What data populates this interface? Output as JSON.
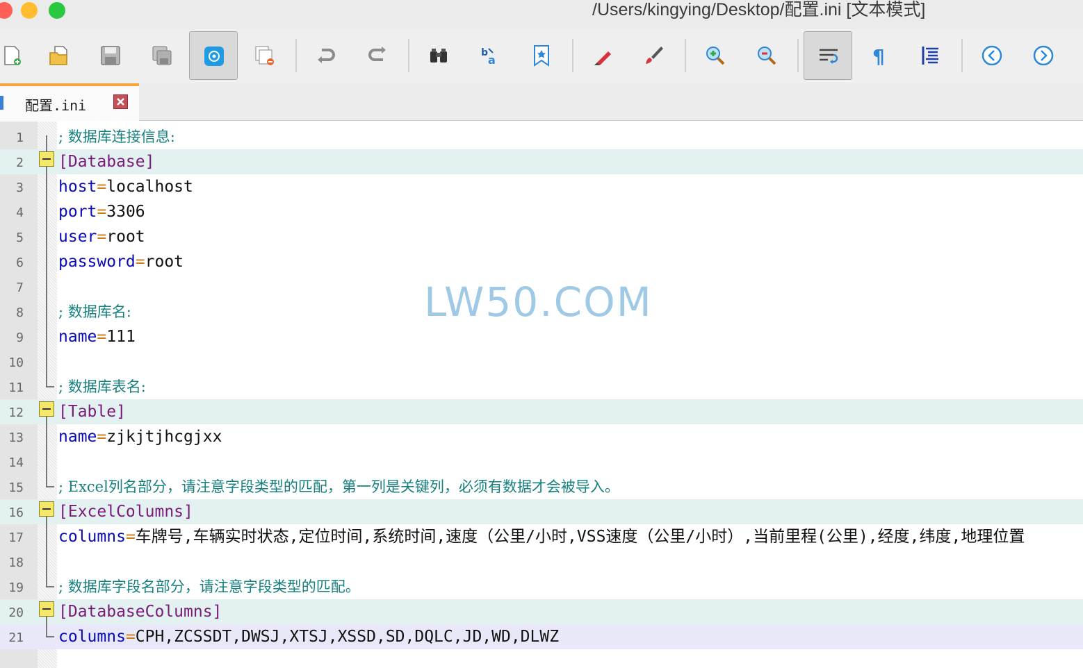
{
  "window": {
    "title": "/Users/kingying/Desktop/配置.ini [文本模式]"
  },
  "toolbar": {
    "buttons": [
      {
        "icon": "new-file-icon",
        "active": false
      },
      {
        "icon": "open-file-icon",
        "active": false
      },
      {
        "icon": "save-icon",
        "active": false
      },
      {
        "icon": "save-all-icon",
        "active": false
      },
      {
        "icon": "at-mode-icon",
        "active": true
      },
      {
        "icon": "close-file-icon",
        "active": false
      },
      {
        "icon": "undo-icon",
        "active": false
      },
      {
        "icon": "redo-icon",
        "active": false
      },
      {
        "icon": "find-icon",
        "active": false
      },
      {
        "icon": "replace-icon",
        "active": false
      },
      {
        "icon": "bookmark-icon",
        "active": false
      },
      {
        "icon": "marker-icon",
        "active": false
      },
      {
        "icon": "brush-icon",
        "active": false
      },
      {
        "icon": "zoom-in-icon",
        "active": false
      },
      {
        "icon": "zoom-out-icon",
        "active": false
      },
      {
        "icon": "word-wrap-icon",
        "active": true
      },
      {
        "icon": "show-symbols-icon",
        "active": false
      },
      {
        "icon": "indent-guide-icon",
        "active": false
      },
      {
        "icon": "previous-icon",
        "active": false
      },
      {
        "icon": "next-icon",
        "active": false
      }
    ]
  },
  "tabs": [
    {
      "label": "配置.ini",
      "active": true
    }
  ],
  "editor": {
    "watermark": "LW50.COM",
    "lines": [
      {
        "n": "1",
        "type": "comment",
        "text": "; 数据库连接信息:"
      },
      {
        "n": "2",
        "type": "section",
        "text": "[Database]"
      },
      {
        "n": "3",
        "type": "kv",
        "key": "host",
        "eq": "=",
        "value": "localhost"
      },
      {
        "n": "4",
        "type": "kv",
        "key": "port",
        "eq": "=",
        "value": "3306"
      },
      {
        "n": "5",
        "type": "kv",
        "key": "user",
        "eq": "=",
        "value": "root"
      },
      {
        "n": "6",
        "type": "kv",
        "key": "password",
        "eq": "=",
        "value": "root"
      },
      {
        "n": "7",
        "type": "blank"
      },
      {
        "n": "8",
        "type": "comment",
        "text": "; 数据库名:"
      },
      {
        "n": "9",
        "type": "kv",
        "key": "name",
        "eq": "=",
        "value": "111"
      },
      {
        "n": "10",
        "type": "blank"
      },
      {
        "n": "11",
        "type": "comment",
        "text": "; 数据库表名:"
      },
      {
        "n": "12",
        "type": "section",
        "text": "[Table]"
      },
      {
        "n": "13",
        "type": "kv",
        "key": "name",
        "eq": "=",
        "value": "zjkjtjhcgjxx"
      },
      {
        "n": "14",
        "type": "blank"
      },
      {
        "n": "15",
        "type": "comment",
        "text": "; Excel列名部分，请注意字段类型的匹配，第一列是关键列，必须有数据才会被导入。"
      },
      {
        "n": "16",
        "type": "section",
        "text": "[ExcelColumns]"
      },
      {
        "n": "17",
        "type": "kv",
        "key": "columns",
        "eq": "=",
        "value": "车牌号,车辆实时状态,定位时间,系统时间,速度（公里/小时,VSS速度（公里/小时）,当前里程(公里),经度,纬度,地理位置"
      },
      {
        "n": "18",
        "type": "blank"
      },
      {
        "n": "19",
        "type": "comment",
        "text": "; 数据库字段名部分，请注意字段类型的匹配。"
      },
      {
        "n": "20",
        "type": "section",
        "text": "[DatabaseColumns]"
      },
      {
        "n": "21",
        "type": "kv",
        "key": "columns",
        "eq": "=",
        "value": "CPH,ZCSSDT,DWSJ,XTSJ,XSSD,SD,DQLC,JD,WD,DLWZ",
        "caret": true
      }
    ]
  },
  "colors": {
    "comment": "#16807f",
    "section": "#7a1a7a",
    "key": "#0b0bb5",
    "equals": "#d07a14",
    "tab_accent": "#f5a53a"
  }
}
